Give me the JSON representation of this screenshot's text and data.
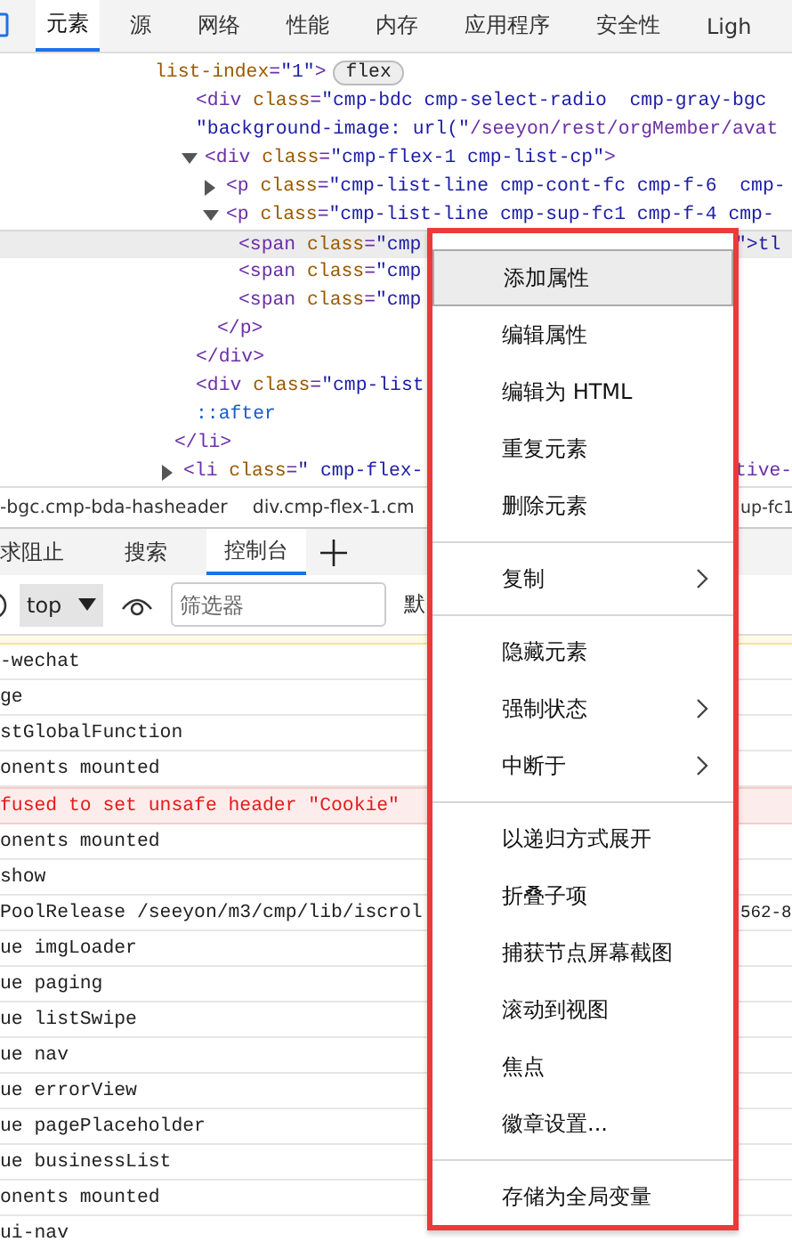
{
  "main_tabs": [
    {
      "label": "元素",
      "selected": true
    },
    {
      "label": "源",
      "selected": false
    },
    {
      "label": "网络",
      "selected": false
    },
    {
      "label": "性能",
      "selected": false
    },
    {
      "label": "内存",
      "selected": false
    },
    {
      "label": "应用程序",
      "selected": false
    },
    {
      "label": "安全性",
      "selected": false
    },
    {
      "label": "Ligh",
      "selected": false
    }
  ],
  "dom_tree": [
    {
      "kind": "wrap",
      "text": "list-index=\"1\">",
      "badge": "flex",
      "selected": false,
      "children": [
        {
          "kind": "tag",
          "text": "<div class=\"cmp-bdc cmp-select-radio  cmp-gray-bgc",
          "selected": false
        },
        {
          "kind": "tag",
          "text": "\"background-image: url(\"/seeyon/rest/orgMember/avat",
          "selected": false
        },
        {
          "kind": "tag",
          "text": "<div class=\"cmp-flex-1 cmp-list-cp\">",
          "expanded": true,
          "selected": false,
          "children": [
            {
              "kind": "tag",
              "text": "<p class=\"cmp-list-line cmp-cont-fc cmp-f-6  cmp-",
              "expanded": false,
              "selected": false
            },
            {
              "kind": "tag",
              "text": "<p class=\"cmp-list-line cmp-sup-fc1 cmp-f-4 cmp-",
              "expanded": true,
              "selected": false,
              "children": [
                {
                  "kind": "tag",
                  "text": "<span class=\"cmp",
                  "tail": "\">tl",
                  "selected": true
                },
                {
                  "kind": "tag",
                  "text": "<span class=\"cmp",
                  "selected": false
                },
                {
                  "kind": "tag",
                  "text": "<span class=\"cmp",
                  "selected": false
                }
              ]
            },
            {
              "kind": "tag",
              "text": "</p>",
              "selected": false
            }
          ]
        },
        {
          "kind": "tag",
          "text": "</div>",
          "selected": false
        },
        {
          "kind": "tag",
          "text": "<div class=\"cmp-list",
          "selected": false
        },
        {
          "kind": "pseudo",
          "text": "::after",
          "selected": false
        }
      ]
    },
    {
      "kind": "tag",
      "text": "</li>",
      "selected": false
    },
    {
      "kind": "tag",
      "text": "<li class=\" cmp-flex-",
      "tail": "tive-",
      "expanded": false,
      "selected": false
    }
  ],
  "breadcrumbs": {
    "items": [
      "-bgc.cmp-bda-hasheader",
      "div.cmp-flex-1.cm"
    ],
    "tail": "up-fc1"
  },
  "drawer_tabs": [
    {
      "label": "求阻止",
      "selected": false
    },
    {
      "label": "搜索",
      "selected": false
    },
    {
      "label": "控制台",
      "selected": true
    }
  ],
  "console_toolbar": {
    "context": "top",
    "filter_placeholder": "筛选器",
    "levels": "默"
  },
  "console_rows": [
    {
      "kind": "warning"
    },
    {
      "kind": "log",
      "text": "-wechat"
    },
    {
      "kind": "log",
      "text": "ge"
    },
    {
      "kind": "log",
      "text": "stGlobalFunction"
    },
    {
      "kind": "log",
      "text": "onents mounted"
    },
    {
      "kind": "error",
      "text": "fused to set unsafe header \"Cookie\""
    },
    {
      "kind": "log",
      "text": "onents mounted"
    },
    {
      "kind": "log",
      "text": "show"
    },
    {
      "kind": "log",
      "text": "PoolRelease /seeyon/m3/cmp/lib/iscrol",
      "tail": "562-8"
    },
    {
      "kind": "log",
      "text": "ue imgLoader"
    },
    {
      "kind": "log",
      "text": "ue paging"
    },
    {
      "kind": "log",
      "text": "ue listSwipe"
    },
    {
      "kind": "log",
      "text": "ue nav"
    },
    {
      "kind": "log",
      "text": "ue errorView"
    },
    {
      "kind": "log",
      "text": "ue pagePlaceholder"
    },
    {
      "kind": "log",
      "text": "ue businessList"
    },
    {
      "kind": "log",
      "text": "onents mounted"
    },
    {
      "kind": "log",
      "text": "ui-nav"
    }
  ],
  "context_menu": [
    {
      "kind": "action",
      "label": "添加属性",
      "selected": true
    },
    {
      "kind": "action",
      "label": "编辑属性",
      "selected": false
    },
    {
      "kind": "action",
      "label": "编辑为 HTML",
      "selected": false
    },
    {
      "kind": "action",
      "label": "重复元素",
      "selected": false
    },
    {
      "kind": "action",
      "label": "删除元素",
      "selected": false
    },
    {
      "kind": "separator"
    },
    {
      "kind": "submenu",
      "label": "复制",
      "selected": false
    },
    {
      "kind": "separator"
    },
    {
      "kind": "action",
      "label": "隐藏元素",
      "selected": false
    },
    {
      "kind": "submenu",
      "label": "强制状态",
      "selected": false
    },
    {
      "kind": "submenu",
      "label": "中断于",
      "selected": false
    },
    {
      "kind": "separator"
    },
    {
      "kind": "action",
      "label": "以递归方式展开",
      "selected": false
    },
    {
      "kind": "action",
      "label": "折叠子项",
      "selected": false
    },
    {
      "kind": "action",
      "label": "捕获节点屏幕截图",
      "selected": false
    },
    {
      "kind": "action",
      "label": "滚动到视图",
      "selected": false
    },
    {
      "kind": "action",
      "label": "焦点",
      "selected": false
    },
    {
      "kind": "action",
      "label": "徽章设置...",
      "selected": false
    },
    {
      "kind": "separator"
    },
    {
      "kind": "action",
      "label": "存储为全局变量",
      "selected": false
    }
  ]
}
